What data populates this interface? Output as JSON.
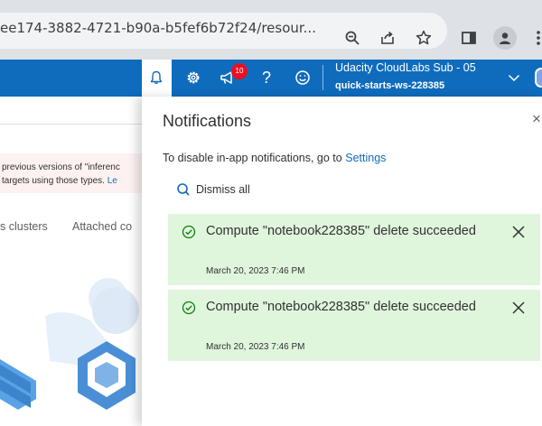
{
  "browser": {
    "url": "ee174-3882-4721-b90a-b5fef6b72f24/resour...",
    "icons": [
      "zoom-icon",
      "share-icon",
      "bookmark-star-icon",
      "side-panel-icon",
      "profile-icon",
      "more-icon"
    ]
  },
  "header": {
    "notification_badge": "10",
    "help_label": "?",
    "account_name": "Udacity CloudLabs Sub - 05",
    "account_directory": "quick-starts-ws-228385",
    "icons": [
      "bell-icon",
      "gear-icon",
      "feedback-megaphone-icon",
      "help-icon",
      "smiley-icon",
      "chevron-down-icon"
    ],
    "brand_color": "#0f6cbd"
  },
  "background_page": {
    "warning_line1": "previous versions of \"inferenc",
    "warning_line2": "targets using those types.",
    "warning_link": "Le",
    "tabs": [
      "s clusters",
      "Attached co"
    ]
  },
  "notifications_panel": {
    "title": "Notifications",
    "close_label": "×",
    "disable_text": "To disable in-app notifications, go to",
    "settings_link": "Settings",
    "dismiss_all": "Dismiss all",
    "success_color": "#dff6dd",
    "items": [
      {
        "title": "Compute \"notebook228385\" delete succeeded",
        "time": "March 20, 2023 7:46 PM",
        "status": "success"
      },
      {
        "title": "Compute \"notebook228385\" delete succeeded",
        "time": "March 20, 2023 7:46 PM",
        "status": "success"
      }
    ]
  }
}
